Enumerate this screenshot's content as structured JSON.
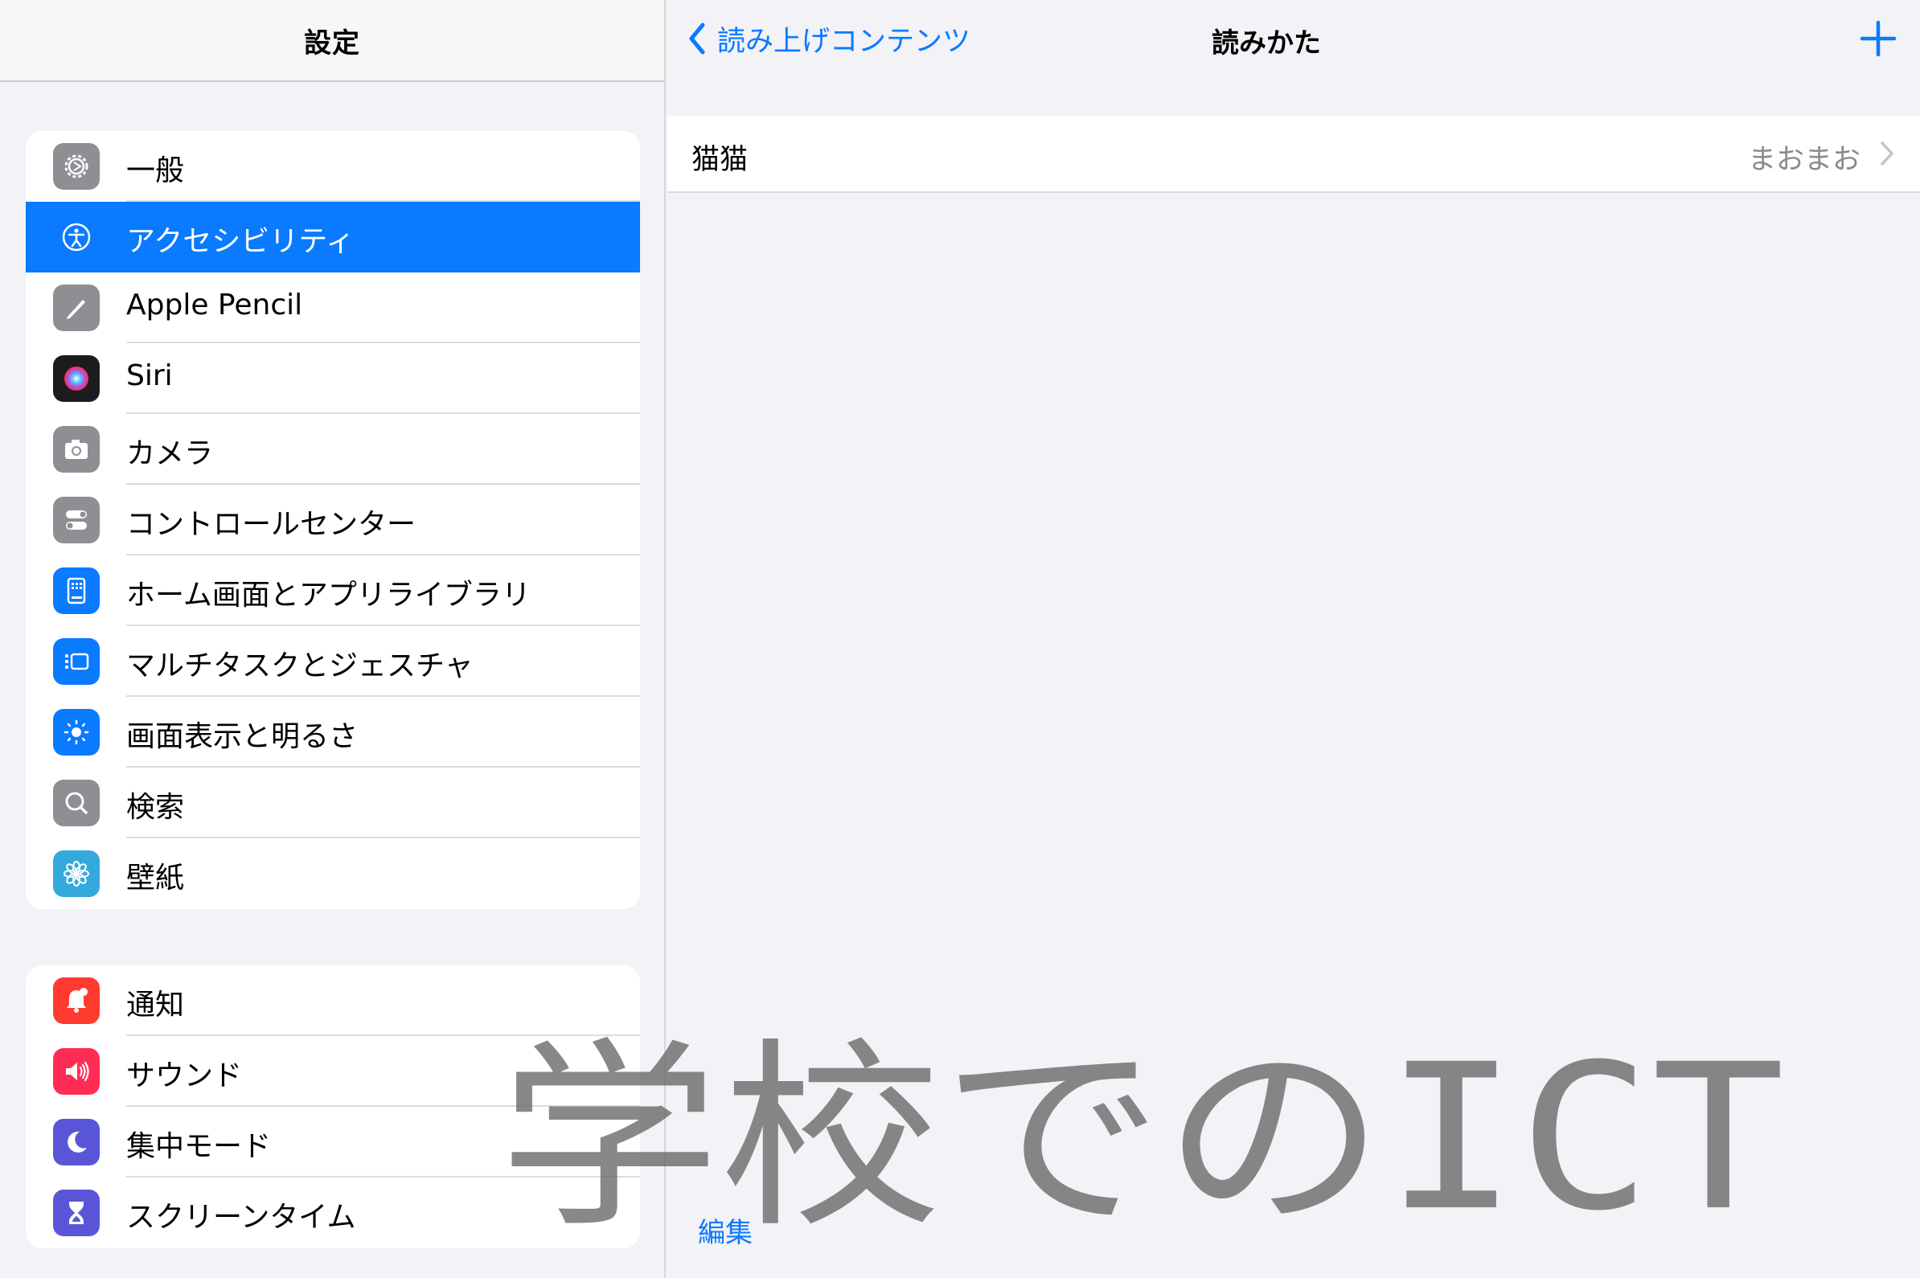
{
  "sidebar": {
    "title": "設定",
    "group1": [
      {
        "label": "一般",
        "icon": "gear-icon",
        "color": "#8e8e93"
      },
      {
        "label": "アクセシビリティ",
        "icon": "accessibility-icon",
        "color": "#0a7aff",
        "selected": true
      },
      {
        "label": "Apple Pencil",
        "icon": "pencil-icon",
        "color": "#8e8e93"
      },
      {
        "label": "Siri",
        "icon": "siri-icon",
        "color": "#1c1c1e"
      },
      {
        "label": "カメラ",
        "icon": "camera-icon",
        "color": "#8e8e93"
      },
      {
        "label": "コントロールセンター",
        "icon": "control-center-icon",
        "color": "#8e8e93"
      },
      {
        "label": "ホーム画面とアプリライブラリ",
        "icon": "home-screen-icon",
        "color": "#0a7aff"
      },
      {
        "label": "マルチタスクとジェスチャ",
        "icon": "multitasking-icon",
        "color": "#0a7aff"
      },
      {
        "label": "画面表示と明るさ",
        "icon": "brightness-icon",
        "color": "#0a7aff"
      },
      {
        "label": "検索",
        "icon": "search-icon",
        "color": "#8e8e93"
      },
      {
        "label": "壁紙",
        "icon": "wallpaper-icon",
        "color": "#34aadc"
      }
    ],
    "group2": [
      {
        "label": "通知",
        "icon": "notification-bell-icon",
        "color": "#ff3b30"
      },
      {
        "label": "サウンド",
        "icon": "speaker-icon",
        "color": "#ff2d55"
      },
      {
        "label": "集中モード",
        "icon": "moon-icon",
        "color": "#5856d6"
      },
      {
        "label": "スクリーンタイム",
        "icon": "hourglass-icon",
        "color": "#5856d6"
      }
    ]
  },
  "detail": {
    "back_label": "読み上げコンテンツ",
    "title": "読みかた",
    "add_icon": "plus-icon",
    "entries": [
      {
        "term": "猫猫",
        "reading": "まおまお"
      }
    ],
    "edit_label": "編集"
  },
  "watermark": {
    "text": "学校でのICT"
  },
  "colors": {
    "accent": "#0a7aff",
    "background": "#f2f2f7",
    "separator": "#dcdce0",
    "secondary_text": "#8a8a8e"
  }
}
